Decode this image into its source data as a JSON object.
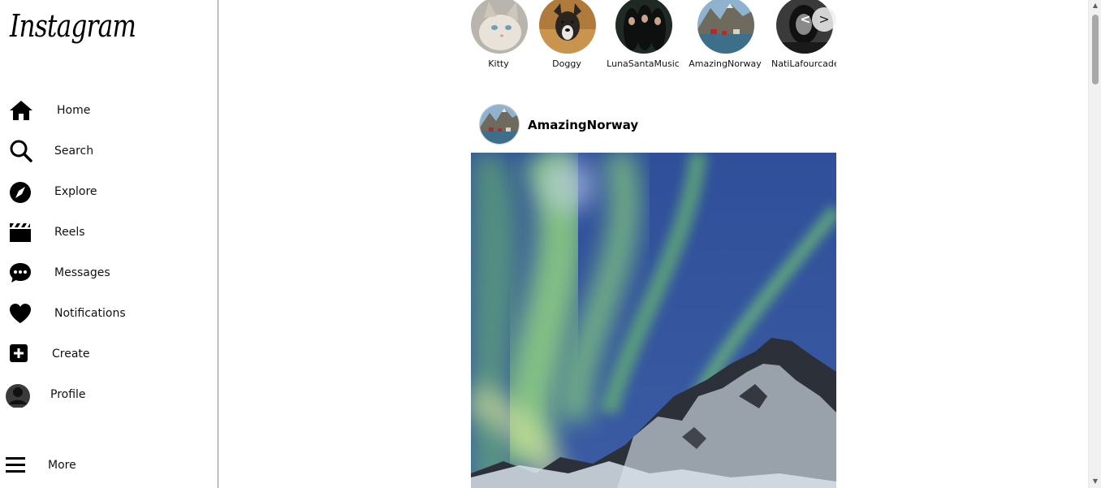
{
  "app": {
    "logo_text": "Instagram"
  },
  "sidebar": {
    "items": [
      {
        "label": "Home",
        "icon": "home-icon"
      },
      {
        "label": "Search",
        "icon": "search-icon"
      },
      {
        "label": "Explore",
        "icon": "compass-icon"
      },
      {
        "label": "Reels",
        "icon": "clapperboard-icon"
      },
      {
        "label": "Messages",
        "icon": "chat-bubble-icon"
      },
      {
        "label": "Notifications",
        "icon": "heart-icon"
      },
      {
        "label": "Create",
        "icon": "plus-square-icon"
      },
      {
        "label": "Profile",
        "icon": "avatar-icon"
      }
    ],
    "more": {
      "label": "More",
      "icon": "hamburger-menu-icon"
    }
  },
  "stories": {
    "items": [
      {
        "name": "Kitty"
      },
      {
        "name": "Doggy"
      },
      {
        "name": "LunaSantaMusic"
      },
      {
        "name": "AmazingNorway"
      },
      {
        "name": "NatiLafourcade"
      }
    ],
    "prev_label": "<",
    "next_label": ">"
  },
  "post": {
    "username": "AmazingNorway",
    "image": "aurora-borealis-over-snowy-mountains"
  },
  "colors": {
    "sidebar_border": "#8e8e8e",
    "aurora_green": "#7fd46a",
    "night_sky": "#2d4a8a"
  }
}
